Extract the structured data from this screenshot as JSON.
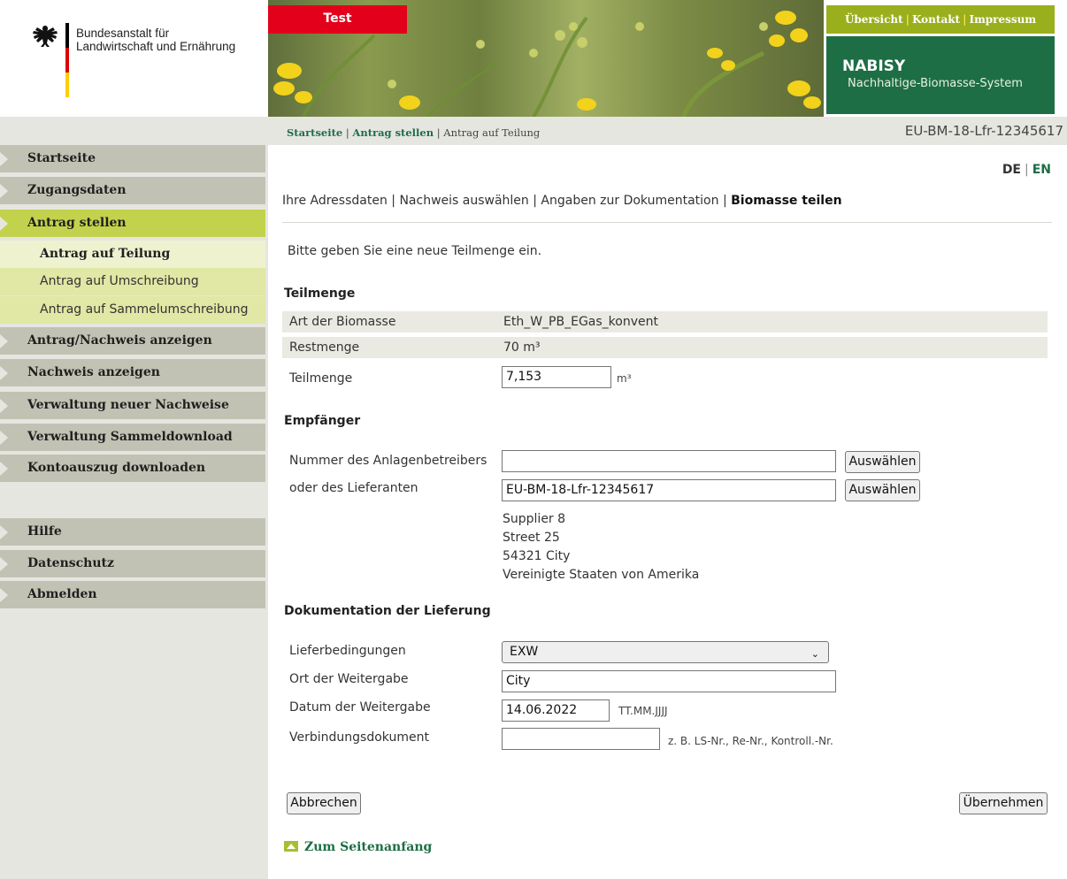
{
  "header": {
    "agency_line1": "Bundesanstalt für",
    "agency_line2": "Landwirtschaft und Ernährung",
    "test_label": "Test",
    "top_links": [
      "Übersicht",
      "Kontakt",
      "Impressum"
    ],
    "system_title": "NABISY",
    "system_subtitle": "Nachhaltige-Biomasse-System"
  },
  "breadcrumb": {
    "items": [
      "Startseite",
      "Antrag stellen",
      "Antrag auf Teilung"
    ],
    "separator": "|"
  },
  "account_id": "EU-BM-18-Lfr-12345617",
  "sidebar": {
    "items": [
      {
        "label": "Startseite"
      },
      {
        "label": "Zugangsdaten"
      },
      {
        "label": "Antrag stellen"
      },
      {
        "label": "Antrag auf Teilung"
      },
      {
        "label": "Antrag auf Umschreibung"
      },
      {
        "label": "Antrag auf Sammelumschreibung"
      },
      {
        "label": "Antrag/Nachweis anzeigen"
      },
      {
        "label": "Nachweis anzeigen"
      },
      {
        "label": "Verwaltung neuer Nachweise"
      },
      {
        "label": "Verwaltung Sammeldownload"
      },
      {
        "label": "Kontoauszug downloaden"
      },
      {
        "label": "Hilfe"
      },
      {
        "label": "Datenschutz"
      },
      {
        "label": "Abmelden"
      }
    ]
  },
  "language": {
    "de": "DE",
    "en": "EN",
    "separator": "|"
  },
  "steps": {
    "items": [
      "Ihre Adressdaten",
      "Nachweis auswählen",
      "Angaben zur Dokumentation",
      "Biomasse teilen"
    ],
    "separator": "|"
  },
  "intro": "Bitte geben Sie eine neue Teilmenge ein.",
  "teilmenge": {
    "heading": "Teilmenge",
    "art_label": "Art der Biomasse",
    "art_value": "Eth_W_PB_EGas_konvent",
    "rest_label": "Restmenge",
    "rest_value": "70 m³",
    "teil_label": "Teilmenge",
    "teil_value": "7,153",
    "teil_unit": "m³"
  },
  "empfaenger": {
    "heading": "Empfänger",
    "anlagen_label": "Nummer des Anlagenbetreibers",
    "anlagen_value": "",
    "lieferant_label": "oder des Lieferanten",
    "lieferant_value": "EU-BM-18-Lfr-12345617",
    "select_button": "Auswählen",
    "address": [
      "Supplier 8",
      "Street 25",
      "54321 City",
      "Vereinigte Staaten von Amerika"
    ]
  },
  "dokumentation": {
    "heading": "Dokumentation der Lieferung",
    "liefer_label": "Lieferbedingungen",
    "liefer_value": "EXW",
    "ort_label": "Ort der Weitergabe",
    "ort_value": "City",
    "datum_label": "Datum der Weitergabe",
    "datum_value": "14.06.2022",
    "datum_hint": "TT.MM.JJJJ",
    "verb_label": "Verbindungsdokument",
    "verb_value": "",
    "verb_hint": "z. B. LS-Nr., Re-Nr., Kontroll.-Nr."
  },
  "actions": {
    "cancel": "Abbrechen",
    "submit": "Übernehmen"
  },
  "to_top": "Zum Seitenanfang",
  "colors": {
    "brand_green": "#1d6e45",
    "lime": "#9aaf1c",
    "nav_active": "#c3d24c",
    "test_red": "#e3001b"
  },
  "icons": [
    "federal-eagle-icon",
    "nav-arrow-icon",
    "chevron-down-icon",
    "scroll-top-icon"
  ]
}
